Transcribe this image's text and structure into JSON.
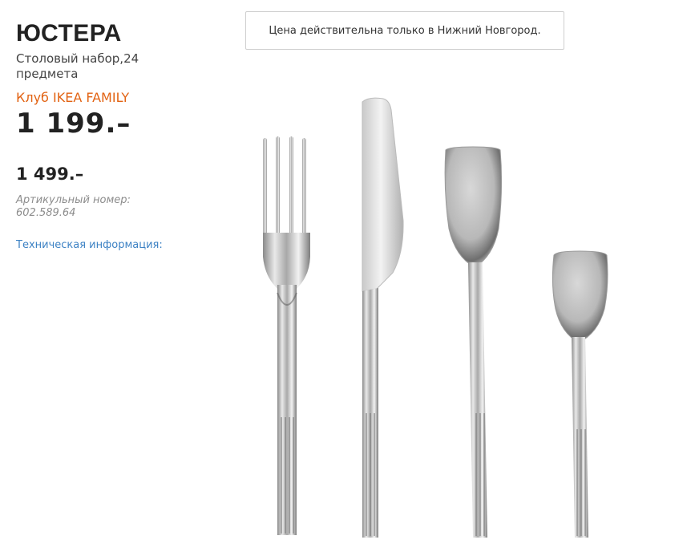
{
  "product": {
    "name": "ЮСТЕРА",
    "description": "Столовый набор,24 предмета",
    "family_label": "Клуб IKEA FAMILY",
    "family_price": "1 199.–",
    "regular_price": "1 499.–",
    "article": "Артикульный номер: 602.589.64",
    "tech_info_link": "Техническая информация:"
  },
  "notice": {
    "text": "Цена действительна только в Нижний Новгород."
  },
  "image": {
    "items": [
      "fork-icon",
      "knife-icon",
      "spoon-icon",
      "teaspoon-icon"
    ]
  },
  "colors": {
    "family_accent": "#e26313",
    "link": "#3d82c4",
    "price": "#222222",
    "muted": "#8c8c8c"
  }
}
